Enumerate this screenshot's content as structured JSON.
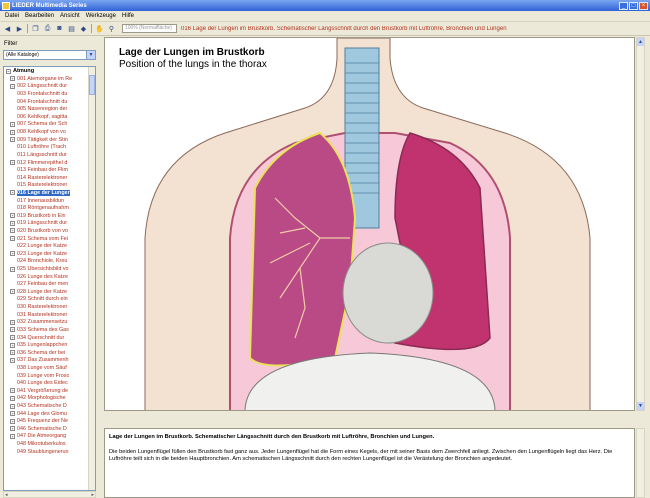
{
  "window": {
    "title": "LIEDER Multimedia Series"
  },
  "menu": [
    "Datei",
    "Bearbeiten",
    "Ansicht",
    "Werkzeuge",
    "Hilfe"
  ],
  "toolbar": {
    "zoom_placeholder": "100% (Normalfläche)",
    "page_title": "016 Lage der Lungen im Brustkorb. Schematischer Längsschnitt durch den Brustkorb mit Luftröhre, Bronchien und Lungen"
  },
  "filter": {
    "label": "Filter",
    "selected": "(Alle Kataloge)"
  },
  "tree": {
    "root": "Atmung",
    "items": [
      {
        "label": "001 Atemorgane im Re",
        "expandable": true,
        "selected": false
      },
      {
        "label": "002 Längsschnitt dur",
        "expandable": true,
        "selected": false
      },
      {
        "label": "003 Frontalschnitt du",
        "expandable": false,
        "selected": false
      },
      {
        "label": "004 Frontalschnitt du",
        "expandable": false,
        "selected": false
      },
      {
        "label": "005 Nasenregion der",
        "expandable": false,
        "selected": false
      },
      {
        "label": "006 Kehlkopf, sagitta",
        "expandable": false,
        "selected": false
      },
      {
        "label": "007 Schema der Sch",
        "expandable": true,
        "selected": false
      },
      {
        "label": "008 Kehlkopf von vo",
        "expandable": true,
        "selected": false
      },
      {
        "label": "009 Tätigkeit der Stin",
        "expandable": true,
        "selected": false
      },
      {
        "label": "010 Luftröhre (Trach",
        "expandable": false,
        "selected": false
      },
      {
        "label": "011 Längsschnitt dur",
        "expandable": false,
        "selected": false
      },
      {
        "label": "012 Flimmerepithel d",
        "expandable": true,
        "selected": false
      },
      {
        "label": "013 Feinbau der Flim",
        "expandable": false,
        "selected": false
      },
      {
        "label": "014 Rasterelektroner",
        "expandable": false,
        "selected": false
      },
      {
        "label": "015 Rasterelektroner",
        "expandable": false,
        "selected": false
      },
      {
        "label": "016 Lage der Lunger",
        "expandable": true,
        "selected": true
      },
      {
        "label": "017 Innenausbildun",
        "expandable": false,
        "selected": false
      },
      {
        "label": "018 Röntgenaufnahm",
        "expandable": false,
        "selected": false
      },
      {
        "label": "019 Brustkorb in Ein",
        "expandable": true,
        "selected": false
      },
      {
        "label": "019 Längsschnitt dur",
        "expandable": true,
        "selected": false
      },
      {
        "label": "020 Brustkorb von vo",
        "expandable": true,
        "selected": false
      },
      {
        "label": "021 Schema vom Fei",
        "expandable": true,
        "selected": false
      },
      {
        "label": "022 Lunge der Katze",
        "expandable": false,
        "selected": false
      },
      {
        "label": "023 Lunge der Katze",
        "expandable": true,
        "selected": false
      },
      {
        "label": "024 Bronchiole, Kreu",
        "expandable": false,
        "selected": false
      },
      {
        "label": "025 Übersichtsbild vo",
        "expandable": true,
        "selected": false
      },
      {
        "label": "026 Lunge des Katze",
        "expandable": false,
        "selected": false
      },
      {
        "label": "027 Feinbau der men",
        "expandable": false,
        "selected": false
      },
      {
        "label": "028 Lunge der Katze",
        "expandable": true,
        "selected": false
      },
      {
        "label": "029 Schnitt durch ein",
        "expandable": false,
        "selected": false
      },
      {
        "label": "030 Rasterelektroner",
        "expandable": false,
        "selected": false
      },
      {
        "label": "031 Rasterelektroner",
        "expandable": false,
        "selected": false
      },
      {
        "label": "032 Zusammensetzu",
        "expandable": true,
        "selected": false
      },
      {
        "label": "033 Schema des Gas",
        "expandable": true,
        "selected": false
      },
      {
        "label": "034 Querschnitt dur",
        "expandable": true,
        "selected": false
      },
      {
        "label": "035 Lungenlappchen",
        "expandable": true,
        "selected": false
      },
      {
        "label": "036 Schema der bei",
        "expandable": true,
        "selected": false
      },
      {
        "label": "037 Das Zusammenh",
        "expandable": true,
        "selected": false
      },
      {
        "label": "038 Lunge vom Säuf",
        "expandable": false,
        "selected": false
      },
      {
        "label": "039 Lunge vom Froso",
        "expandable": false,
        "selected": false
      },
      {
        "label": "040 Lunge des Eidec",
        "expandable": false,
        "selected": false
      },
      {
        "label": "041 Vergrößerung de",
        "expandable": true,
        "selected": false
      },
      {
        "label": "042 Morphologische",
        "expandable": true,
        "selected": false
      },
      {
        "label": "043 Schematische D",
        "expandable": true,
        "selected": false
      },
      {
        "label": "044 Lage des Glomu",
        "expandable": true,
        "selected": false
      },
      {
        "label": "045 Frequenz der Ne",
        "expandable": true,
        "selected": false
      },
      {
        "label": "046 Schematische D",
        "expandable": true,
        "selected": false
      },
      {
        "label": "047 Die Atmeorgang",
        "expandable": true,
        "selected": false
      },
      {
        "label": "048 Mikrotuberkulos",
        "expandable": false,
        "selected": false
      },
      {
        "label": "049 Staublungenerun",
        "expandable": false,
        "selected": false
      }
    ]
  },
  "image": {
    "title_de": "Lage der Lungen im Brustkorb",
    "title_en": "Position of the lungs in the thorax"
  },
  "caption": {
    "headline": "Lage der Lungen im Brustkorb. Schematischer Längsschnitt durch den Brustkorb mit Luftröhre, Bronchien und Lungen.",
    "body": "Die beiden Lungenflügel füllen den Brustkorb fast ganz aus. Jeder Lungenflügel hat die Form eines Kegels, der mit seiner Basis dem Zwerchfell anliegt. Zwischen den Lungenflügeln liegt das Herz. Die Luftröhre teilt sich in die beiden Hauptbronchien. Am schematischen Längsschnitt durch den rechten Lungenflügel ist die Verästelung der Bronchien angedeutet."
  },
  "colors": {
    "accent_text": "#b3321f",
    "selection": "#316ac5",
    "lung_left": "#c0336f",
    "lung_right": "#c95a8c",
    "skin": "#f3e1d2"
  },
  "icons": [
    "back-icon",
    "forward-icon",
    "copy-icon",
    "print-icon",
    "camera-icon",
    "book-icon",
    "tag-icon",
    "hand-icon",
    "zoom-icon"
  ]
}
